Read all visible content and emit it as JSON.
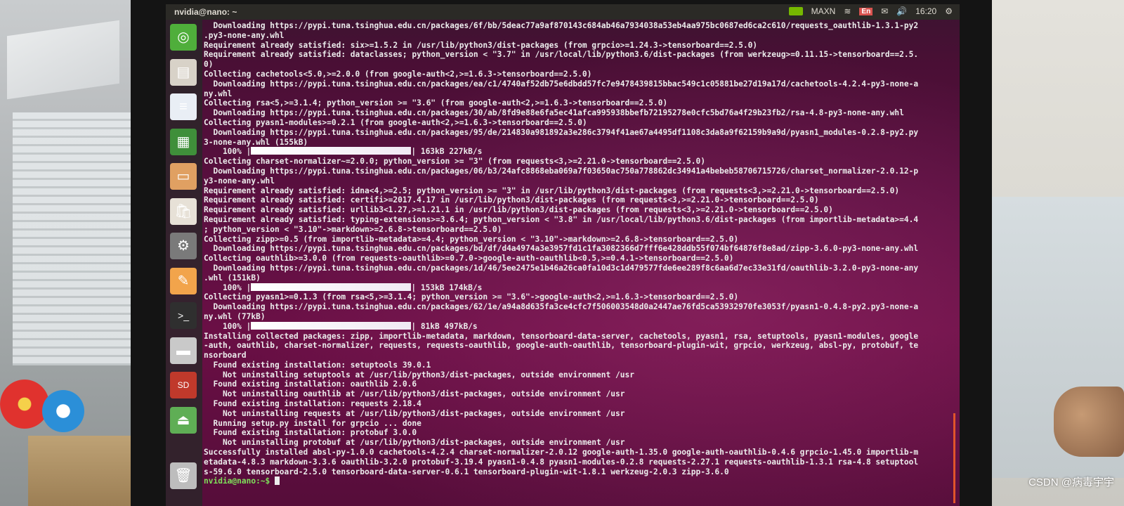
{
  "panel": {
    "title": "nvidia@nano: ~",
    "power_mode": "MAXN",
    "lang": "En",
    "clock": "16:20",
    "icons": [
      "nvidia-icon",
      "battery-icon",
      "wifi-icon",
      "keyboard-lang-icon",
      "mail-icon",
      "speaker-icon",
      "clock",
      "gear-icon"
    ]
  },
  "launcher": {
    "items": [
      {
        "name": "dash-icon",
        "glyph": "◎",
        "bg": "#4fae3b"
      },
      {
        "name": "files-icon",
        "glyph": "▤",
        "bg": "#d8d2c8"
      },
      {
        "name": "writer-icon",
        "glyph": "≡",
        "bg": "#e9eef5"
      },
      {
        "name": "calc-icon",
        "glyph": "▦",
        "bg": "#3f8f3a"
      },
      {
        "name": "impress-icon",
        "glyph": "▭",
        "bg": "#e0a062"
      },
      {
        "name": "software-center-icon",
        "glyph": "🛍",
        "bg": "#e7e1d7"
      },
      {
        "name": "system-settings-icon",
        "glyph": "⚙",
        "bg": "#7a7a7a"
      },
      {
        "name": "text-editor-icon",
        "glyph": "✎",
        "bg": "#f2a44b"
      },
      {
        "name": "terminal-icon",
        "glyph": ">_",
        "bg": "#2f2f2f"
      },
      {
        "name": "drive-icon",
        "glyph": "▬",
        "bg": "#c9c9c9"
      },
      {
        "name": "sd-card-icon",
        "glyph": "SD",
        "bg": "#c0392b"
      },
      {
        "name": "usb-drive-icon",
        "glyph": "⏏",
        "bg": "#5fae55"
      },
      {
        "name": "trash-icon",
        "glyph": "🗑",
        "bg": "#bdbdbd"
      }
    ]
  },
  "terminal": {
    "lines": [
      "  Downloading https://pypi.tuna.tsinghua.edu.cn/packages/6f/bb/5deac77a9af870143c684ab46a7934038a53eb4aa975bc0687ed6ca2c610/requests_oauthlib-1.3.1-py2",
      ".py3-none-any.whl",
      "Requirement already satisfied: six>=1.5.2 in /usr/lib/python3/dist-packages (from grpcio>=1.24.3->tensorboard==2.5.0)",
      "Requirement already satisfied: dataclasses; python_version < \"3.7\" in /usr/local/lib/python3.6/dist-packages (from werkzeug>=0.11.15->tensorboard==2.5.",
      "0)",
      "Collecting cachetools<5.0,>=2.0.0 (from google-auth<2,>=1.6.3->tensorboard==2.5.0)",
      "  Downloading https://pypi.tuna.tsinghua.edu.cn/packages/ea/c1/4740af52db75e6dbdd57fc7e9478439815bbac549c1c05881be27d19a17d/cachetools-4.2.4-py3-none-a",
      "ny.whl",
      "Collecting rsa<5,>=3.1.4; python_version >= \"3.6\" (from google-auth<2,>=1.6.3->tensorboard==2.5.0)",
      "  Downloading https://pypi.tuna.tsinghua.edu.cn/packages/30/ab/8fd9e88e6fa5ec41afca995938bbefb72195278e0cfc5bd76a4f29b23fb2/rsa-4.8-py3-none-any.whl",
      "Collecting pyasn1-modules>=0.2.1 (from google-auth<2,>=1.6.3->tensorboard==2.5.0)",
      "  Downloading https://pypi.tuna.tsinghua.edu.cn/packages/95/de/214830a981892a3e286c3794f41ae67a4495df1108c3da8a9f62159b9a9d/pyasn1_modules-0.2.8-py2.py",
      "3-none-any.whl (155kB)",
      {
        "pct": "    100% |",
        "tail": "| 163kB 227kB/s"
      },
      "Collecting charset-normalizer~=2.0.0; python_version >= \"3\" (from requests<3,>=2.21.0->tensorboard==2.5.0)",
      "  Downloading https://pypi.tuna.tsinghua.edu.cn/packages/06/b3/24afc8868eba069a7f03650ac750a778862dc34941a4bebeb58706715726/charset_normalizer-2.0.12-p",
      "y3-none-any.whl",
      "Requirement already satisfied: idna<4,>=2.5; python_version >= \"3\" in /usr/lib/python3/dist-packages (from requests<3,>=2.21.0->tensorboard==2.5.0)",
      "Requirement already satisfied: certifi>=2017.4.17 in /usr/lib/python3/dist-packages (from requests<3,>=2.21.0->tensorboard==2.5.0)",
      "Requirement already satisfied: urllib3<1.27,>=1.21.1 in /usr/lib/python3/dist-packages (from requests<3,>=2.21.0->tensorboard==2.5.0)",
      "Requirement already satisfied: typing-extensions>=3.6.4; python_version < \"3.8\" in /usr/local/lib/python3.6/dist-packages (from importlib-metadata>=4.4",
      "; python_version < \"3.10\"->markdown>=2.6.8->tensorboard==2.5.0)",
      "Collecting zipp>=0.5 (from importlib-metadata>=4.4; python_version < \"3.10\"->markdown>=2.6.8->tensorboard==2.5.0)",
      "  Downloading https://pypi.tuna.tsinghua.edu.cn/packages/bd/df/d4a4974a3e3957fd1c1fa3082366d7fff6e428ddb55f074bf64876f8e8ad/zipp-3.6.0-py3-none-any.whl",
      "Collecting oauthlib>=3.0.0 (from requests-oauthlib>=0.7.0->google-auth-oauthlib<0.5,>=0.4.1->tensorboard==2.5.0)",
      "  Downloading https://pypi.tuna.tsinghua.edu.cn/packages/1d/46/5ee2475e1b46a26ca0fa10d3c1d479577fde6ee289f8c6aa6d7ec33e31fd/oauthlib-3.2.0-py3-none-any",
      ".whl (151kB)",
      {
        "pct": "    100% |",
        "tail": "| 153kB 174kB/s"
      },
      "Collecting pyasn1>=0.1.3 (from rsa<5,>=3.1.4; python_version >= \"3.6\"->google-auth<2,>=1.6.3->tensorboard==2.5.0)",
      "  Downloading https://pypi.tuna.tsinghua.edu.cn/packages/62/1e/a94a8d635fa3ce4cfc7f506003548d0a2447ae76fd5ca53932970fe3053f/pyasn1-0.4.8-py2.py3-none-a",
      "ny.whl (77kB)",
      {
        "pct": "    100% |",
        "tail": "| 81kB 497kB/s"
      },
      "Installing collected packages: zipp, importlib-metadata, markdown, tensorboard-data-server, cachetools, pyasn1, rsa, setuptools, pyasn1-modules, google",
      "-auth, oauthlib, charset-normalizer, requests, requests-oauthlib, google-auth-oauthlib, tensorboard-plugin-wit, grpcio, werkzeug, absl-py, protobuf, te",
      "nsorboard",
      "  Found existing installation: setuptools 39.0.1",
      "    Not uninstalling setuptools at /usr/lib/python3/dist-packages, outside environment /usr",
      "  Found existing installation: oauthlib 2.0.6",
      "    Not uninstalling oauthlib at /usr/lib/python3/dist-packages, outside environment /usr",
      "  Found existing installation: requests 2.18.4",
      "    Not uninstalling requests at /usr/lib/python3/dist-packages, outside environment /usr",
      "  Running setup.py install for grpcio ... done",
      "  Found existing installation: protobuf 3.0.0",
      "    Not uninstalling protobuf at /usr/lib/python3/dist-packages, outside environment /usr",
      "Successfully installed absl-py-1.0.0 cachetools-4.2.4 charset-normalizer-2.0.12 google-auth-1.35.0 google-auth-oauthlib-0.4.6 grpcio-1.45.0 importlib-m",
      "etadata-4.8.3 markdown-3.3.6 oauthlib-3.2.0 protobuf-3.19.4 pyasn1-0.4.8 pyasn1-modules-0.2.8 requests-2.27.1 requests-oauthlib-1.3.1 rsa-4.8 setuptool",
      "s-59.6.0 tensorboard-2.5.0 tensorboard-data-server-0.6.1 tensorboard-plugin-wit-1.8.1 werkzeug-2.0.3 zipp-3.6.0"
    ],
    "prompt": "nvidia@nano:~$ "
  },
  "watermark": "CSDN @病毒宇宇",
  "colors": {
    "prompt": "#7ee05a",
    "text": "#ececec",
    "panel": "#2b2a26",
    "accent": "#e0552a"
  }
}
